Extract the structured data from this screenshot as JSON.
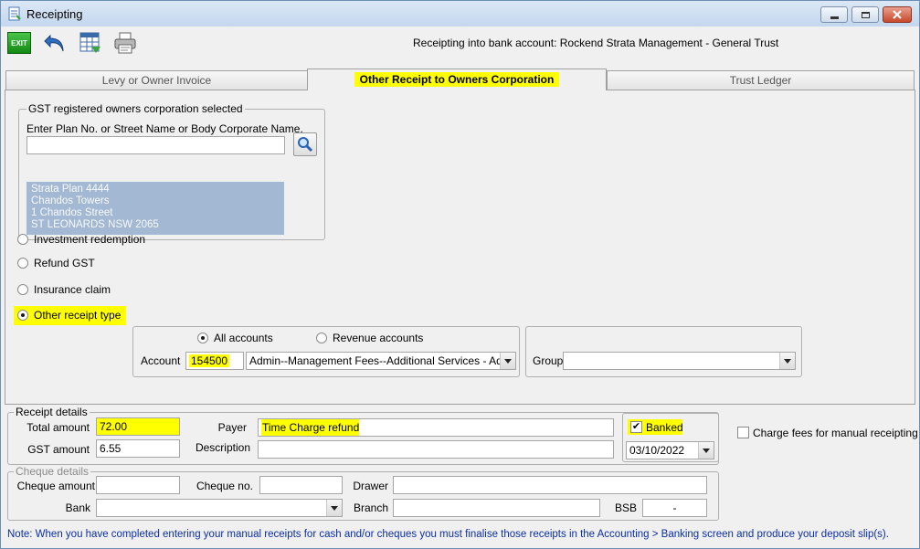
{
  "window": {
    "title": "Receipting"
  },
  "toolbar": {
    "exit_label": "EXIT",
    "bank_account_text": "Receipting into bank account: Rockend Strata Management - General Trust"
  },
  "tabs": [
    {
      "label": "Levy or Owner Invoice"
    },
    {
      "label": "Other Receipt to Owners Corporation"
    },
    {
      "label": "Trust Ledger"
    }
  ],
  "owners_corp": {
    "group_label": "GST registered owners corporation selected",
    "search_label": "Enter Plan No. or Street Name or Body Corporate Name.",
    "search_value": "",
    "address_lines": [
      "Strata Plan 4444",
      "Chandos Towers",
      "1 Chandos Street",
      "ST LEONARDS  NSW  2065"
    ]
  },
  "receipt_types": [
    {
      "label": "Investment redemption",
      "selected": false
    },
    {
      "label": "Refund GST",
      "selected": false
    },
    {
      "label": "Insurance claim",
      "selected": false
    },
    {
      "label": "Other receipt type",
      "selected": true
    }
  ],
  "account_selection": {
    "filter_options": [
      {
        "label": "All accounts",
        "selected": true
      },
      {
        "label": "Revenue accounts",
        "selected": false
      }
    ],
    "account_label": "Account",
    "account_code": "154500",
    "account_name": "Admin--Management Fees--Additional Services - Admin",
    "group_label": "Group",
    "group_value": ""
  },
  "receipt_details": {
    "group_label": "Receipt details",
    "total_amount_label": "Total amount",
    "total_amount": "72.00",
    "gst_amount_label": "GST amount",
    "gst_amount": "6.55",
    "payer_label": "Payer",
    "payer": "Time Charge refund",
    "description_label": "Description",
    "description": "",
    "banked_label": "Banked",
    "banked": true,
    "banked_date": "03/10/2022",
    "charge_fees_label": "Charge fees for manual receipting",
    "charge_fees": false
  },
  "cheque_details": {
    "group_label": "Cheque details",
    "cheque_amount_label": "Cheque amount",
    "cheque_amount": "",
    "cheque_no_label": "Cheque no.",
    "cheque_no": "",
    "drawer_label": "Drawer",
    "drawer": "",
    "bank_label": "Bank",
    "bank": "",
    "branch_label": "Branch",
    "branch": "",
    "bsb_label": "BSB",
    "bsb": "-"
  },
  "footer_note": "Note: When you have completed entering your manual receipts for cash and/or cheques you must finalise those receipts in the Accounting > Banking screen and produce your deposit slip(s).",
  "colors": {
    "highlight": "#ffff00",
    "address_bg": "#a3b8d3",
    "note_text": "#0b2ea8"
  },
  "icons": [
    "exit-icon",
    "undo-icon",
    "spreadsheet-icon",
    "printer-icon",
    "search-icon",
    "minimize-icon",
    "maximize-icon",
    "close-icon"
  ]
}
